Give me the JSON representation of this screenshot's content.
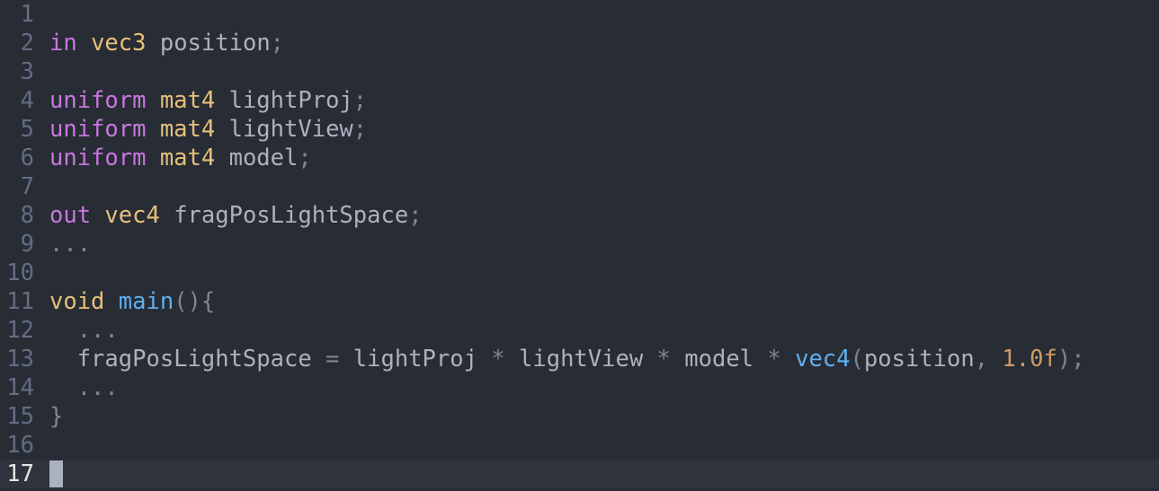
{
  "theme": {
    "background": "#282c34",
    "current_line_background": "#2f333d",
    "line_number_color": "#636d83",
    "current_line_number_color": "#e6e6e6",
    "keyword_color": "#c678dd",
    "type_color": "#e5c07b",
    "function_color": "#61afef",
    "number_color": "#d19a66",
    "text_color": "#abb2bf",
    "cursor_color": "#abb2bf"
  },
  "editor": {
    "current_line": 17,
    "lines": [
      {
        "number": "1",
        "tokens": []
      },
      {
        "number": "2",
        "tokens": [
          {
            "t": "in",
            "c": "kw"
          },
          {
            "t": " ",
            "c": "pl"
          },
          {
            "t": "vec3",
            "c": "ty"
          },
          {
            "t": " position",
            "c": "pl"
          },
          {
            "t": ";",
            "c": "pu"
          }
        ]
      },
      {
        "number": "3",
        "tokens": []
      },
      {
        "number": "4",
        "tokens": [
          {
            "t": "uniform",
            "c": "kw"
          },
          {
            "t": " ",
            "c": "pl"
          },
          {
            "t": "mat4",
            "c": "ty"
          },
          {
            "t": " lightProj",
            "c": "pl"
          },
          {
            "t": ";",
            "c": "pu"
          }
        ]
      },
      {
        "number": "5",
        "tokens": [
          {
            "t": "uniform",
            "c": "kw"
          },
          {
            "t": " ",
            "c": "pl"
          },
          {
            "t": "mat4",
            "c": "ty"
          },
          {
            "t": " lightView",
            "c": "pl"
          },
          {
            "t": ";",
            "c": "pu"
          }
        ]
      },
      {
        "number": "6",
        "tokens": [
          {
            "t": "uniform",
            "c": "kw"
          },
          {
            "t": " ",
            "c": "pl"
          },
          {
            "t": "mat4",
            "c": "ty"
          },
          {
            "t": " model",
            "c": "pl"
          },
          {
            "t": ";",
            "c": "pu"
          }
        ]
      },
      {
        "number": "7",
        "tokens": []
      },
      {
        "number": "8",
        "tokens": [
          {
            "t": "out",
            "c": "kw"
          },
          {
            "t": " ",
            "c": "pl"
          },
          {
            "t": "vec4",
            "c": "ty"
          },
          {
            "t": " fragPosLightSpace",
            "c": "pl"
          },
          {
            "t": ";",
            "c": "pu"
          }
        ]
      },
      {
        "number": "9",
        "tokens": [
          {
            "t": "...",
            "c": "pu"
          }
        ]
      },
      {
        "number": "10",
        "tokens": []
      },
      {
        "number": "11",
        "tokens": [
          {
            "t": "void",
            "c": "ty"
          },
          {
            "t": " ",
            "c": "pl"
          },
          {
            "t": "main",
            "c": "fn"
          },
          {
            "t": "(){",
            "c": "pu"
          }
        ]
      },
      {
        "number": "12",
        "tokens": [
          {
            "t": "  ...",
            "c": "pu"
          }
        ]
      },
      {
        "number": "13",
        "tokens": [
          {
            "t": "  fragPosLightSpace ",
            "c": "pl"
          },
          {
            "t": "=",
            "c": "pu"
          },
          {
            "t": " lightProj ",
            "c": "pl"
          },
          {
            "t": "*",
            "c": "pu"
          },
          {
            "t": " lightView ",
            "c": "pl"
          },
          {
            "t": "*",
            "c": "pu"
          },
          {
            "t": " model ",
            "c": "pl"
          },
          {
            "t": "*",
            "c": "pu"
          },
          {
            "t": " ",
            "c": "pl"
          },
          {
            "t": "vec4",
            "c": "fn"
          },
          {
            "t": "(",
            "c": "pu"
          },
          {
            "t": "position",
            "c": "pl"
          },
          {
            "t": ",",
            "c": "pu"
          },
          {
            "t": " ",
            "c": "pl"
          },
          {
            "t": "1.0f",
            "c": "num"
          },
          {
            "t": ");",
            "c": "pu"
          }
        ]
      },
      {
        "number": "14",
        "tokens": [
          {
            "t": "  ...",
            "c": "pu"
          }
        ]
      },
      {
        "number": "15",
        "tokens": [
          {
            "t": "}",
            "c": "pu"
          }
        ]
      },
      {
        "number": "16",
        "tokens": []
      },
      {
        "number": "17",
        "tokens": []
      }
    ]
  }
}
